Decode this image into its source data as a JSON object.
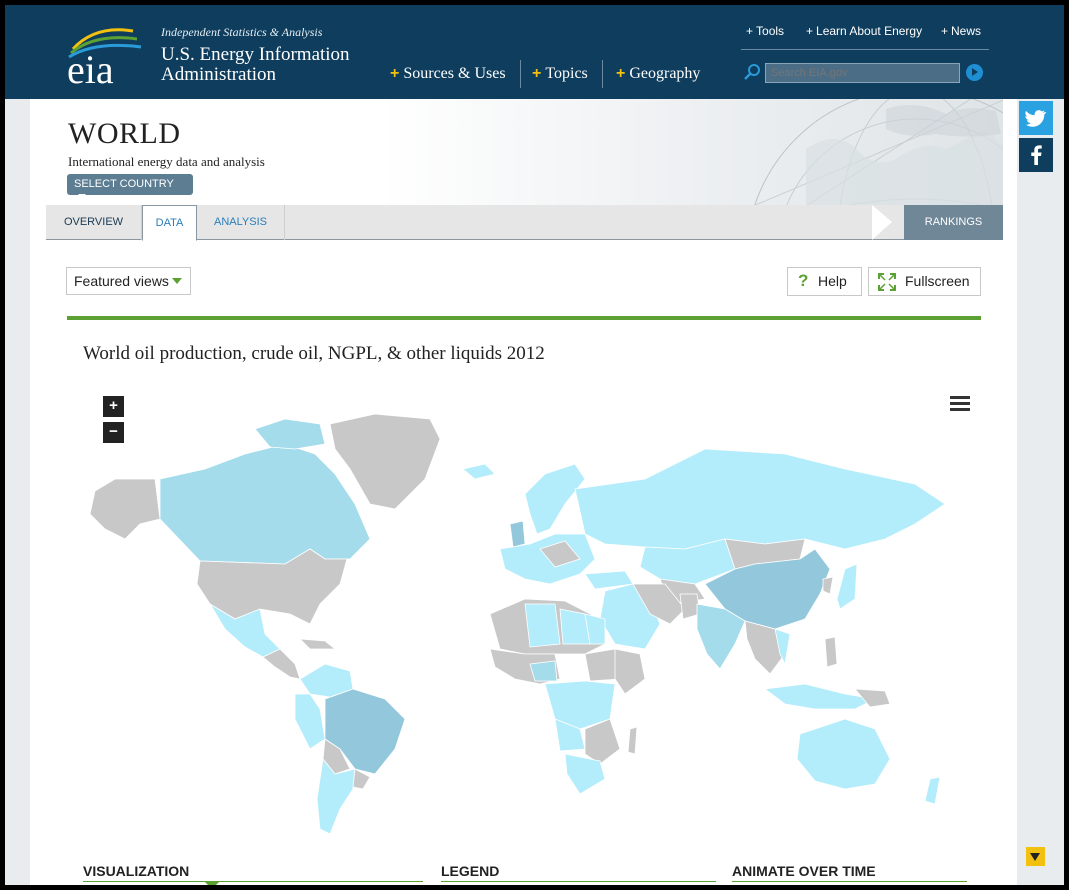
{
  "header": {
    "tagline": "Independent Statistics & Analysis",
    "org_line1": "U.S. Energy Information",
    "org_line2": "Administration",
    "logo_text": "eia",
    "utility_links": [
      "Tools",
      "Learn About Energy",
      "News"
    ],
    "main_nav": [
      "Sources & Uses",
      "Topics",
      "Geography"
    ],
    "search_placeholder": "Search EIA.gov"
  },
  "page": {
    "title": "WORLD",
    "subtitle": "International energy data and analysis",
    "select_country": "SELECT COUNTRY",
    "tabs": [
      "OVERVIEW",
      "DATA",
      "ANALYSIS"
    ],
    "active_tab": "DATA",
    "rankings": "RANKINGS"
  },
  "toolbar": {
    "featured_views": "Featured views",
    "help": "Help",
    "fullscreen": "Fullscreen"
  },
  "map": {
    "title": "World oil production, crude oil, NGPL, & other liquids 2012",
    "zoom_in": "+",
    "zoom_out": "−",
    "colors": {
      "no_data": "#c8c8c8",
      "low": "#b3ecfb",
      "mid": "#a4dcec",
      "high": "#93c8dc"
    }
  },
  "bottom": {
    "visualization": "VISUALIZATION",
    "legend": "LEGEND",
    "animate": "ANIMATE OVER TIME"
  },
  "social": {
    "twitter": "twitter-icon",
    "facebook": "facebook-icon"
  }
}
